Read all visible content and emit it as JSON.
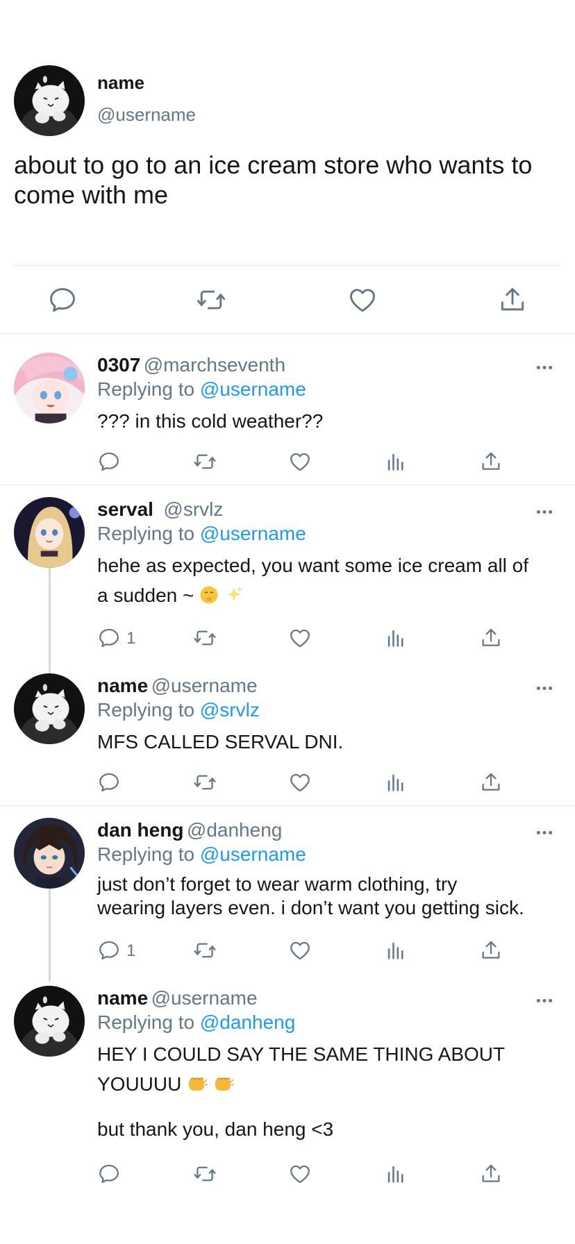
{
  "main_tweet": {
    "name": "name",
    "handle": "@username",
    "text": "about to go to an ice cream store who wants to come with me"
  },
  "replies": [
    {
      "name": "0307",
      "handle": "@marchseventh",
      "replying_prefix": "Replying to",
      "replying_to": "@username",
      "text": "??? in this cold weather??",
      "reply_count": ""
    },
    {
      "name": "serval",
      "handle": "@srvlz",
      "replying_prefix": "Replying to",
      "replying_to": "@username",
      "text_line1": "hehe as expected, you want some ice cream all of",
      "text_line2": "a sudden ~",
      "emojis": [
        "shushing-face-emoji",
        "sparkles-emoji"
      ],
      "reply_count": "1"
    },
    {
      "name": "name",
      "handle": "@username",
      "replying_prefix": "Replying to",
      "replying_to": "@srvlz",
      "text": "MFS CALLED SERVAL DNI.",
      "reply_count": ""
    },
    {
      "name": "dan heng",
      "handle": "@danheng",
      "replying_prefix": "Replying to",
      "replying_to": "@username",
      "text_line1": "just don’t forget to wear warm clothing, try",
      "text_line2": "wearing layers even. i don’t want you getting sick.",
      "reply_count": "1"
    },
    {
      "name": "name",
      "handle": "@username",
      "replying_prefix": "Replying to",
      "replying_to": "@danheng",
      "text_line1": "HEY I COULD SAY THE SAME THING ABOUT",
      "text_line2": "YOUUUU",
      "emojis": [
        "fist-bump-emoji",
        "fist-bump-emoji"
      ],
      "text_line3": "but thank you, dan heng <3",
      "reply_count": ""
    }
  ],
  "icons": {
    "reply": "reply-icon",
    "retweet": "retweet-icon",
    "like": "like-icon",
    "views": "views-icon",
    "share": "share-icon",
    "more": "more-icon"
  },
  "colors": {
    "text": "#14171a",
    "muted": "#657786",
    "mention": "#1d9bf0",
    "divider": "#e1e8ed"
  }
}
